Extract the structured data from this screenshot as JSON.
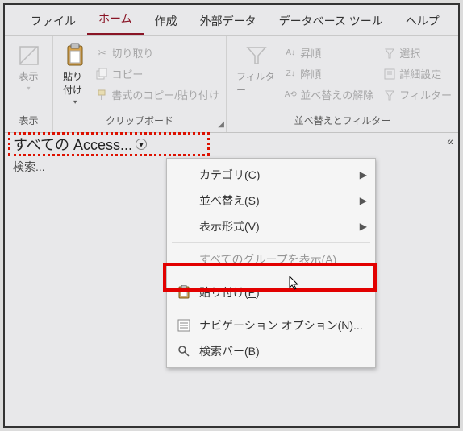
{
  "tabs": {
    "file": "ファイル",
    "home": "ホーム",
    "create": "作成",
    "external": "外部データ",
    "dbtools": "データベース ツール",
    "help": "ヘルプ"
  },
  "ribbon": {
    "view_group": {
      "label": "表示",
      "view_btn": "表示"
    },
    "clipboard_group": {
      "label": "クリップボード",
      "paste_btn": "貼り付け",
      "cut": "切り取り",
      "copy": "コピー",
      "format_painter": "書式のコピー/貼り付け"
    },
    "sortfilter_group": {
      "label": "並べ替えとフィルター",
      "filter_btn": "フィルター",
      "asc": "昇順",
      "desc": "降順",
      "clear_sort": "並べ替えの解除",
      "selection": "選択",
      "advanced": "詳細設定",
      "toggle_filter": "フィルター"
    }
  },
  "navpane": {
    "title": "すべての Access...",
    "search": "検索..."
  },
  "ctxmenu": {
    "category": "カテゴリ(C)",
    "sort": "並べ替え(S)",
    "display": "表示形式(V)",
    "show_all_groups": "すべてのグループを表示(A)",
    "paste_pre": "貼り付け(",
    "paste_post": ")",
    "paste_key": "P",
    "navoptions": "ナビゲーション オプション(N)...",
    "searchbar": "検索バー(B)"
  }
}
